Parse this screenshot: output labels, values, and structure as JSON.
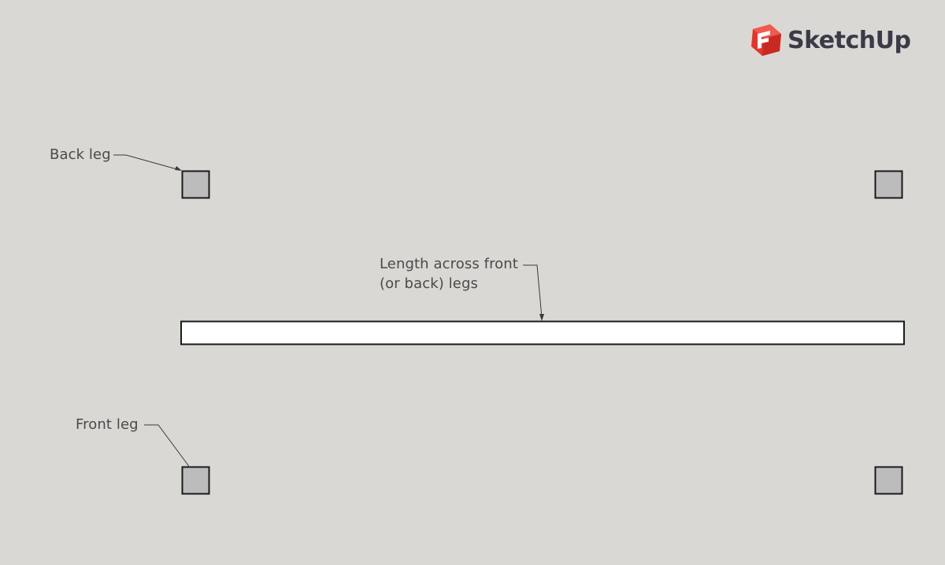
{
  "brand": {
    "name": "SketchUp",
    "logo_icon": "sketchup-logo-icon",
    "logo_color": "#e5352b",
    "text_color": "#3c3a47"
  },
  "colors": {
    "background": "#dad8d4",
    "leg_fill": "#bcbcbc",
    "rail_fill": "#ffffff",
    "stroke": "#1a1a1a",
    "annotation": "#4a4a4a"
  },
  "labels": {
    "back_leg": "Back leg",
    "front_leg": "Front leg",
    "rail_line1": "Length across front",
    "rail_line2": "(or back) legs"
  }
}
